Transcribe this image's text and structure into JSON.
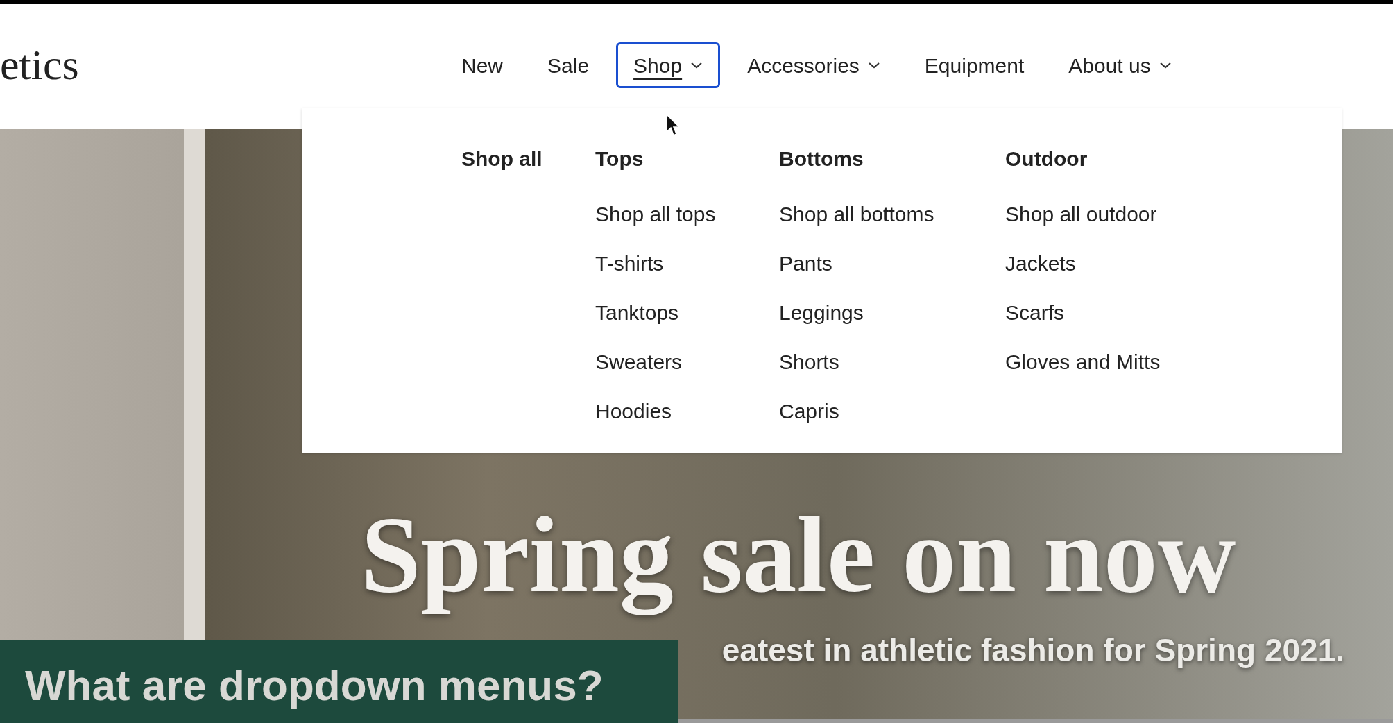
{
  "logo": "etics",
  "nav": [
    {
      "label": "New",
      "selected": false,
      "dropdown": false
    },
    {
      "label": "Sale",
      "selected": false,
      "dropdown": false
    },
    {
      "label": "Shop",
      "selected": true,
      "dropdown": true
    },
    {
      "label": "Accessories",
      "selected": false,
      "dropdown": true
    },
    {
      "label": "Equipment",
      "selected": false,
      "dropdown": false
    },
    {
      "label": "About us",
      "selected": false,
      "dropdown": true
    }
  ],
  "mega_menu": {
    "columns": [
      {
        "heading": "Shop all"
      },
      {
        "heading": "Tops",
        "items": [
          "Shop all tops",
          "T-shirts",
          "Tanktops",
          "Sweaters",
          "Hoodies"
        ]
      },
      {
        "heading": "Bottoms",
        "items": [
          "Shop all bottoms",
          "Pants",
          "Leggings",
          "Shorts",
          "Capris"
        ]
      },
      {
        "heading": "Outdoor",
        "items": [
          "Shop all outdoor",
          "Jackets",
          "Scarfs",
          "Gloves and Mitts"
        ]
      }
    ]
  },
  "hero": {
    "heading": "Spring sale on now",
    "subheading": "eatest in athletic fashion for Spring 2021."
  },
  "caption": "What are dropdown menus?"
}
